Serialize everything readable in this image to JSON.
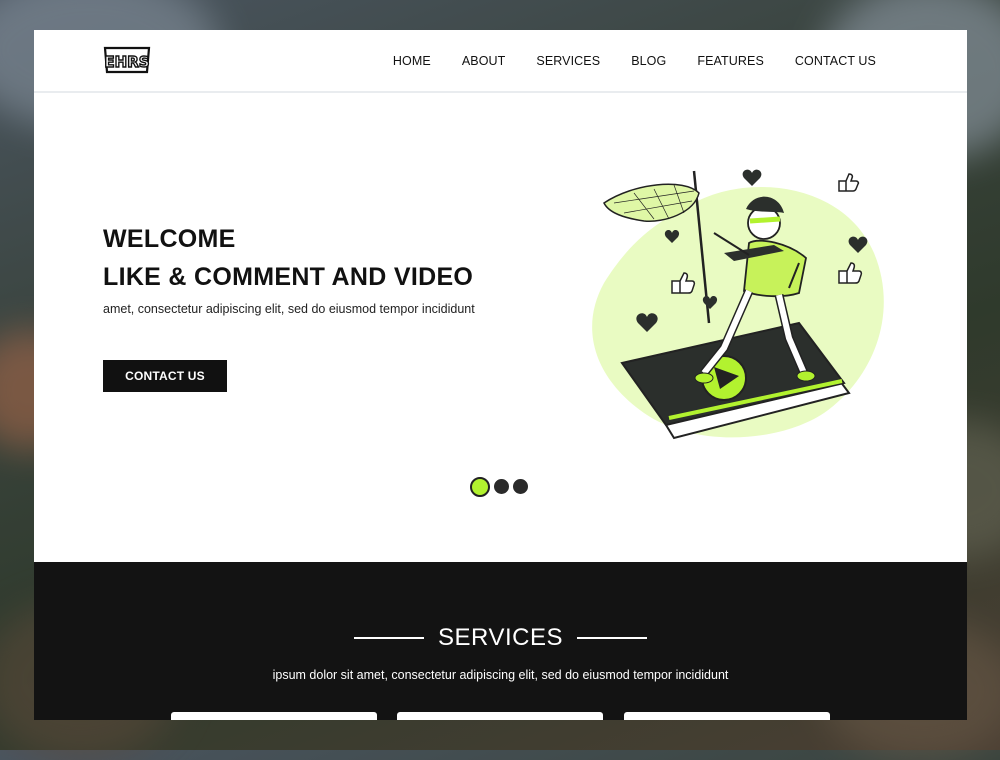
{
  "brand": {
    "logo_text": "EHRS"
  },
  "nav": {
    "items": [
      "HOME",
      "ABOUT",
      "SERVICES",
      "BLOG",
      "FEATURES",
      "CONTACT US"
    ]
  },
  "hero": {
    "title_line1": "WELCOME",
    "title_line2": "LIKE & COMMENT AND VIDEO",
    "subtitle": "amet, consectetur adipiscing elit, sed do eiusmod tempor incididunt",
    "cta_label": "CONTACT US"
  },
  "slider": {
    "count": 3,
    "active_index": 0
  },
  "services": {
    "title": "SERVICES",
    "description": "ipsum dolor sit amet, consectetur adipiscing elit, sed do eiusmod tempor incididunt"
  },
  "colors": {
    "accent": "#b2f22f",
    "dark": "#131313",
    "text": "#111111"
  },
  "icons": [
    "heart-icon",
    "thumbs-up-icon",
    "play-icon"
  ]
}
